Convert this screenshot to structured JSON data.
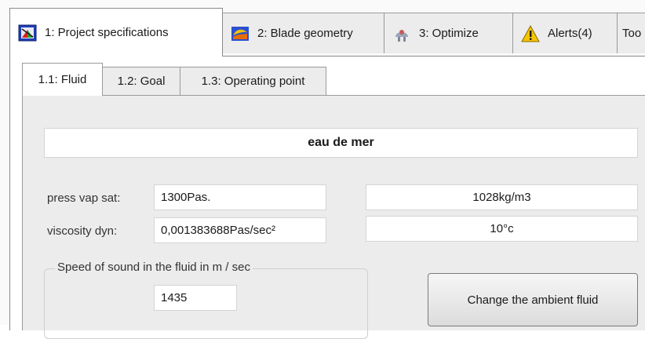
{
  "outer_tabs": [
    {
      "label": "1: Project specifications",
      "icon": "project-specifications-icon"
    },
    {
      "label": "2: Blade geometry",
      "icon": "blade-geometry-icon"
    },
    {
      "label": "3: Optimize",
      "icon": "optimize-icon"
    },
    {
      "label": "Alerts(4)",
      "icon": "warning-icon"
    },
    {
      "label": "Too"
    }
  ],
  "inner_tabs": [
    {
      "label": "1.1: Fluid"
    },
    {
      "label": "1.2: Goal"
    },
    {
      "label": "1.3: Operating point"
    }
  ],
  "fluid": {
    "name": "eau de mer",
    "press_vap_sat_label": "press vap sat:",
    "press_vap_sat_value": "1300Pas.",
    "viscosity_label": "viscosity dyn:",
    "viscosity_value": "0,001383688Pas/sec²",
    "density_value": "1028kg/m3",
    "temperature_value": "10°c"
  },
  "sound": {
    "legend": "Speed of sound in the fluid in m / sec",
    "value": "1435"
  },
  "buttons": {
    "change_fluid": "Change the ambient fluid"
  }
}
